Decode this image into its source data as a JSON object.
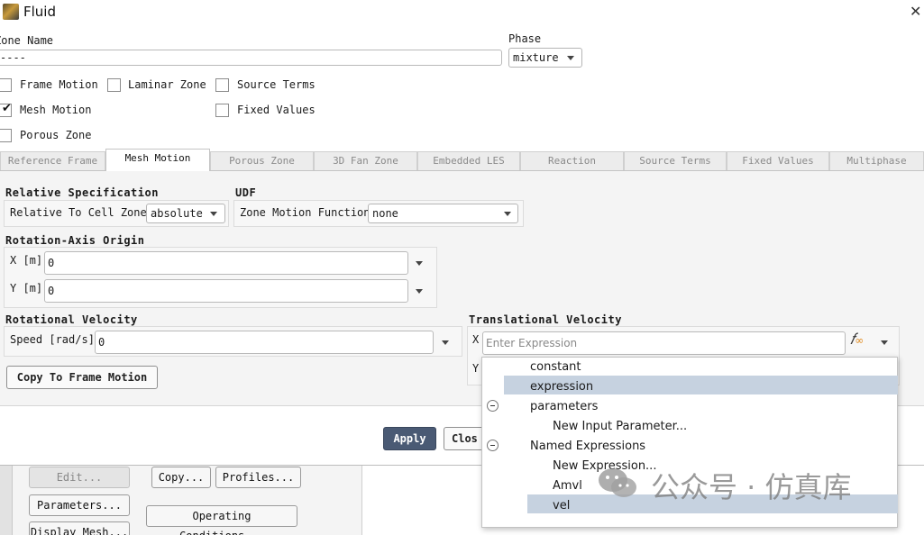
{
  "window": {
    "title": "Fluid"
  },
  "zone": {
    "label": "Zone Name",
    "value": "----"
  },
  "phase": {
    "label": "Phase",
    "value": "mixture"
  },
  "checkboxes": [
    {
      "label": "Frame Motion",
      "checked": false
    },
    {
      "label": "Laminar Zone",
      "checked": false
    },
    {
      "label": "Source Terms",
      "checked": false
    },
    {
      "label": "Mesh Motion",
      "checked": true
    },
    {
      "label": "Fixed Values",
      "checked": false
    },
    {
      "label": "Porous Zone",
      "checked": false
    }
  ],
  "tabs": [
    "Reference Frame",
    "Mesh Motion",
    "Porous Zone",
    "3D Fan Zone",
    "Embedded LES",
    "Reaction",
    "Source Terms",
    "Fixed Values",
    "Multiphase"
  ],
  "active_tab": "Mesh Motion",
  "relative_spec": {
    "heading": "Relative Specification",
    "label": "Relative To Cell Zone",
    "value": "absolute"
  },
  "udf": {
    "heading": "UDF",
    "label": "Zone Motion Function",
    "value": "none"
  },
  "origin": {
    "heading": "Rotation-Axis Origin",
    "x_label": "X [m]",
    "x_value": "0",
    "y_label": "Y [m]",
    "y_value": "0"
  },
  "rot_vel": {
    "heading": "Rotational Velocity",
    "label": "Speed [rad/s]",
    "value": "0"
  },
  "copy_btn": "Copy To Frame Motion",
  "trans_vel": {
    "heading": "Translational Velocity",
    "x_label": "X",
    "y_label": "Y",
    "placeholder": "Enter Expression",
    "fx": "f(x)"
  },
  "popup_menu": {
    "items": [
      "constant",
      "expression",
      "parameters",
      "New Input Parameter...",
      "Named Expressions",
      "New Expression...",
      "Amvl",
      "vel"
    ],
    "highlighted": [
      "expression",
      "vel"
    ]
  },
  "footer": {
    "apply": "Apply",
    "close": "Clos"
  },
  "background": {
    "edit": "Edit...",
    "copy": "Copy...",
    "profiles": "Profiles...",
    "parameters": "Parameters...",
    "operating": "Operating Conditions...",
    "display_mesh": "Display Mesh..."
  },
  "watermark": "公众号 · 仿真库"
}
